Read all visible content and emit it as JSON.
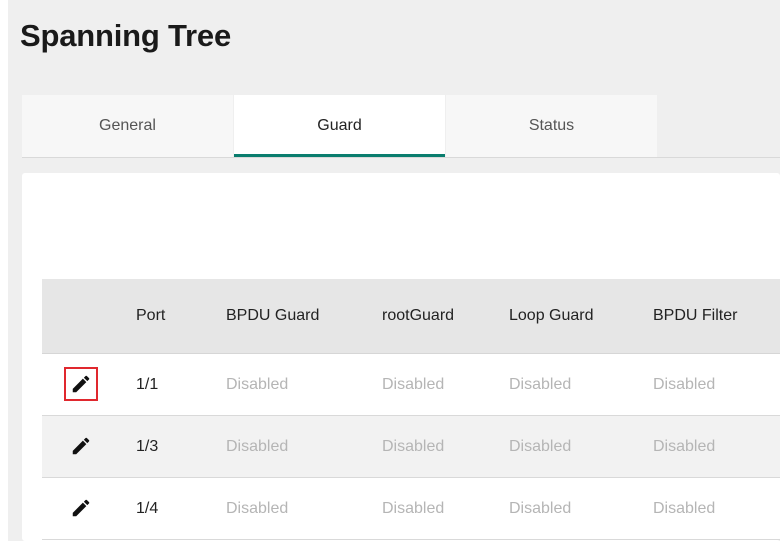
{
  "page": {
    "title": "Spanning Tree"
  },
  "tabs": [
    {
      "label": "General",
      "active": false
    },
    {
      "label": "Guard",
      "active": true
    },
    {
      "label": "Status",
      "active": false
    }
  ],
  "colors": {
    "accent": "#0a7d6e",
    "highlight": "#e0282e"
  },
  "table": {
    "columns": [
      "",
      "Port",
      "BPDU Guard",
      "rootGuard",
      "Loop Guard",
      "BPDU Filter"
    ],
    "rows": [
      {
        "port": "1/1",
        "bpdu_guard": "Disabled",
        "root_guard": "Disabled",
        "loop_guard": "Disabled",
        "bpdu_filter": "Disabled",
        "edit_icon": "pencil-icon"
      },
      {
        "port": "1/3",
        "bpdu_guard": "Disabled",
        "root_guard": "Disabled",
        "loop_guard": "Disabled",
        "bpdu_filter": "Disabled",
        "edit_icon": "pencil-icon"
      },
      {
        "port": "1/4",
        "bpdu_guard": "Disabled",
        "root_guard": "Disabled",
        "loop_guard": "Disabled",
        "bpdu_filter": "Disabled",
        "edit_icon": "pencil-icon"
      }
    ]
  }
}
